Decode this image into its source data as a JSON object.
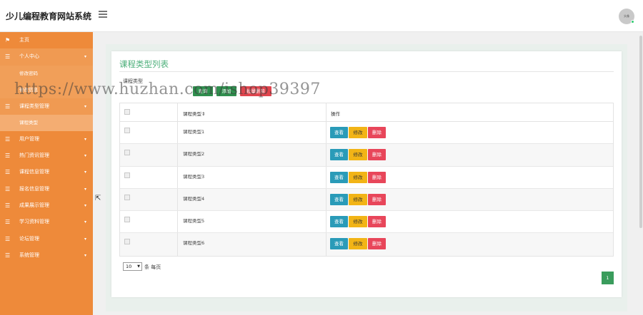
{
  "brand": {
    "title": "少儿编程教育网站系统"
  },
  "header": {
    "avatar_text": "头像"
  },
  "sidebar": {
    "items": [
      {
        "label": "主页",
        "icon": "flag-icon",
        "chevron": ""
      },
      {
        "label": "个人中心",
        "icon": "list-icon",
        "chevron": "▾",
        "subs": [
          {
            "label": "修改密码"
          },
          {
            "label": "修改信息"
          }
        ]
      },
      {
        "label": "课程类型管理",
        "icon": "list-icon",
        "chevron": "▾",
        "subs": [
          {
            "label": "课程类型"
          }
        ]
      },
      {
        "label": "用户管理",
        "icon": "list-icon",
        "chevron": "▾"
      },
      {
        "label": "热门资讯管理",
        "icon": "list-icon",
        "chevron": "▾"
      },
      {
        "label": "课程信息管理",
        "icon": "list-icon",
        "chevron": "▾"
      },
      {
        "label": "报名信息管理",
        "icon": "list-icon",
        "chevron": "▾"
      },
      {
        "label": "成果展示管理",
        "icon": "list-icon",
        "chevron": "▾"
      },
      {
        "label": "学习资料管理",
        "icon": "list-icon",
        "chevron": "▾"
      },
      {
        "label": "论坛管理",
        "icon": "list-icon",
        "chevron": "▾"
      },
      {
        "label": "系统管理",
        "icon": "list-icon",
        "chevron": "▾"
      }
    ]
  },
  "panel": {
    "title": "课程类型列表",
    "filter_label": "课程类型",
    "buttons": {
      "query": "查询",
      "add": "添加",
      "batch_delete": "批量删除"
    }
  },
  "table": {
    "headers": [
      "课程类型",
      "操作"
    ],
    "sort_mark": "⇕",
    "rows": [
      {
        "type": "课程类型1"
      },
      {
        "type": "课程类型2"
      },
      {
        "type": "课程类型3"
      },
      {
        "type": "课程类型4"
      },
      {
        "type": "课程类型5"
      },
      {
        "type": "课程类型6"
      }
    ],
    "actions": {
      "view": "查看",
      "edit": "修改",
      "delete": "删除"
    }
  },
  "pager": {
    "page_size": "10",
    "per_page_label": "条 每页",
    "current_page": "1"
  },
  "watermark": "https://www.huzhan.com/ishop39397",
  "colors": {
    "sidebar": "#ee8a3a",
    "accent": "#4caf7a",
    "view": "#2a9bb8",
    "edit": "#f2b416",
    "delete": "#e8465a"
  }
}
